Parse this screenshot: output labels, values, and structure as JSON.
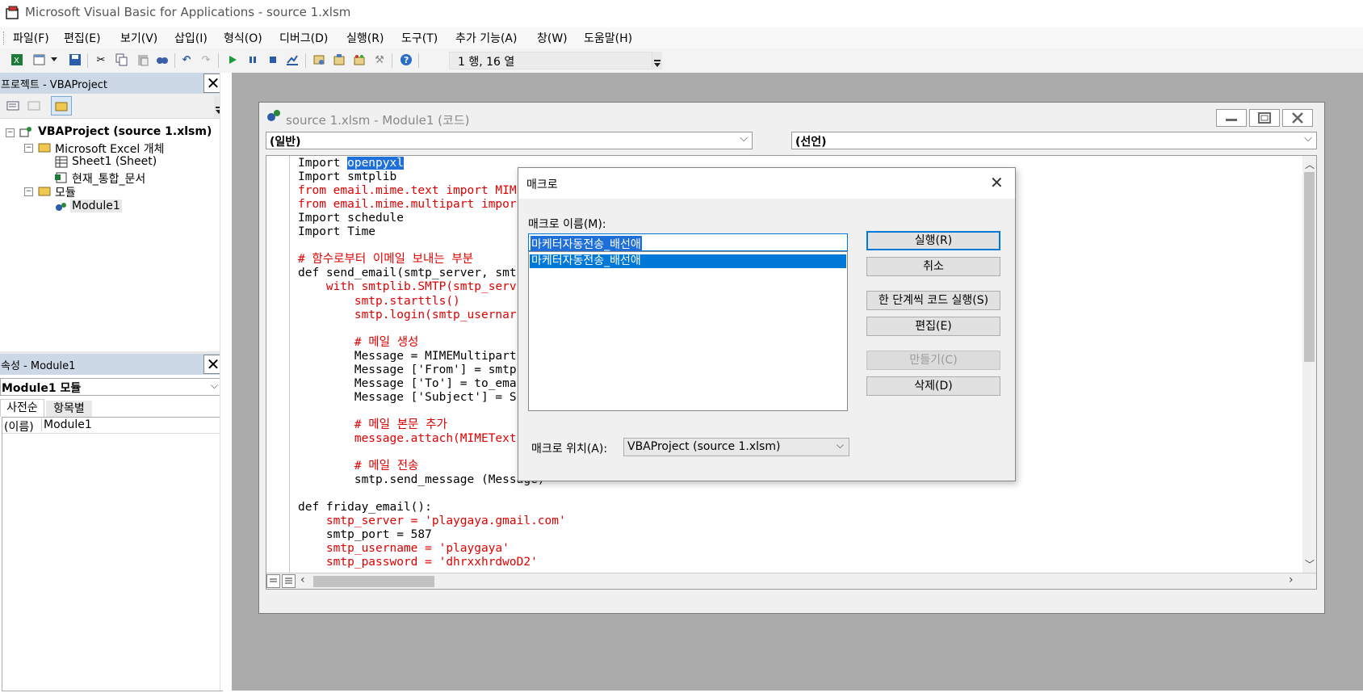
{
  "app": {
    "window_title": "Microsoft Visual Basic for Applications - source 1.xlsm"
  },
  "menu": [
    "파일(F)",
    "편집(E)",
    "보기(V)",
    "삽입(I)",
    "형식(O)",
    "디버그(D)",
    "실행(R)",
    "도구(T)",
    "추가 기능(A)",
    "창(W)",
    "도움말(H)"
  ],
  "toolbar": {
    "cursor_position": "1 행, 16 열",
    "icons": [
      "excel-icon",
      "insert-module-icon",
      "save-icon",
      "cut-icon",
      "copy-icon",
      "paste-icon",
      "find-icon",
      "undo-icon",
      "redo-icon",
      "run-icon",
      "break-icon",
      "reset-icon",
      "design-mode-icon",
      "project-explorer-icon",
      "properties-icon",
      "object-browser-icon",
      "toolbox-icon",
      "help-icon"
    ]
  },
  "project_panel": {
    "title": "프로젝트 - VBAProject",
    "tree": {
      "root": "VBAProject (source 1.xlsm)",
      "excel_objects": "Microsoft Excel 개체",
      "sheet1": "Sheet1 (Sheet)",
      "workbook": "현재_통합_문서",
      "modules": "모듈",
      "module1": "Module1"
    }
  },
  "properties_panel": {
    "title": "속성 - Module1",
    "selector": "Module1 모듈",
    "tab_alpha": "사전순",
    "tab_category": "항목별",
    "prop_name": "(이름)",
    "prop_value": "Module1"
  },
  "code_window": {
    "title": "source 1.xlsm - Module1 (코드)",
    "object_combo": "(일반)",
    "proc_combo": "(선언)",
    "lines": [
      {
        "t": "Import ",
        "hl": "openpyxl",
        "red": false
      },
      {
        "t": "Import smtplib",
        "red": false
      },
      {
        "t": "from email.mime.text import MIM",
        "red": true
      },
      {
        "t": "from email.mime.multipart impor",
        "red": true
      },
      {
        "t": "Import schedule",
        "red": false
      },
      {
        "t": "Import Time",
        "red": false
      },
      {
        "t": "",
        "red": false
      },
      {
        "t": "# 함수로부터 이메일 보내는 부분",
        "red": true
      },
      {
        "t": "def send_email(smtp_server, smt",
        "red": false
      },
      {
        "t": "    with smtplib.SMTP(smtp_serv",
        "red": true
      },
      {
        "t": "        smtp.starttls()",
        "red": true
      },
      {
        "t": "        smtp.login(smtp_usernar",
        "red": true
      },
      {
        "t": "",
        "red": false
      },
      {
        "t": "        # 메일 생성",
        "red": true
      },
      {
        "t": "        Message = MIMEMultipart",
        "red": false
      },
      {
        "t": "        Message ['From'] = smtp",
        "red": false
      },
      {
        "t": "        Message ['To'] = to_ema",
        "red": false
      },
      {
        "t": "        Message ['Subject'] = S",
        "red": false
      },
      {
        "t": "",
        "red": false
      },
      {
        "t": "        # 메일 본문 추가",
        "red": true
      },
      {
        "t": "        message.attach(MIMEText",
        "red": true
      },
      {
        "t": "",
        "red": false
      },
      {
        "t": "        # 메일 전송",
        "red": true
      },
      {
        "t": "        smtp.send_message (Message)",
        "red": false
      },
      {
        "t": "",
        "red": false
      },
      {
        "t": "def friday_email():",
        "red": false
      },
      {
        "t": "    smtp_server = 'playgaya.gmail.com'",
        "red": true
      },
      {
        "t": "    smtp_port = 587",
        "red": false
      },
      {
        "t": "    smtp_username = 'playgaya'",
        "red": true
      },
      {
        "t": "    smtp_password = 'dhrxxhrdwoD2'",
        "red": true
      }
    ]
  },
  "macro_dialog": {
    "title": "매크로",
    "name_label": "매크로 이름(M):",
    "name_value": "마케터자동전송_배선애",
    "list_items": [
      "마케터자동전송_배선애"
    ],
    "buttons": {
      "run": "실행(R)",
      "cancel": "취소",
      "step": "한 단계씩 코드 실행(S)",
      "edit": "편집(E)",
      "create": "만들기(C)",
      "delete": "삭제(D)"
    },
    "location_label": "매크로 위치(A):",
    "location_value": "VBAProject (source 1.xlsm)"
  },
  "colors": {
    "accent": "#0078d7",
    "code_red": "#e00000",
    "panel_header": "#cdd8e6",
    "mdi_bg": "#ababab"
  }
}
